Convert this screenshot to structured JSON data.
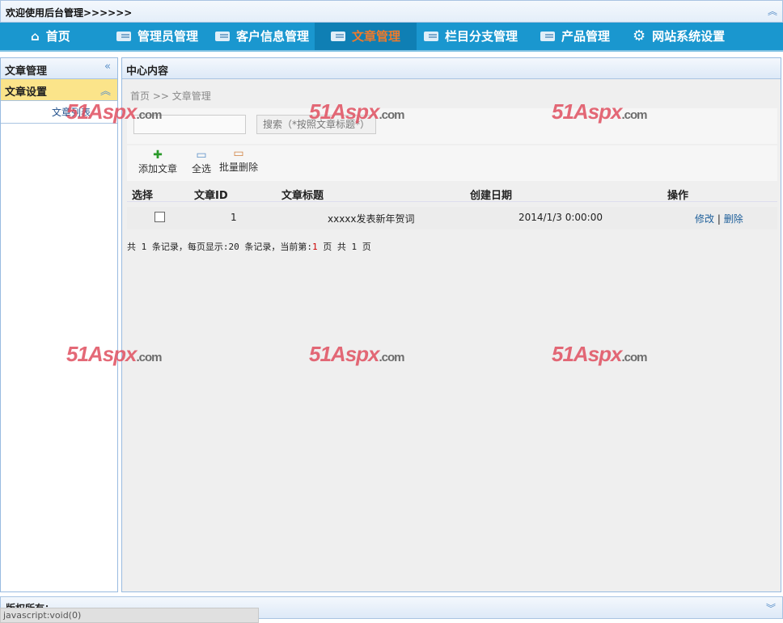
{
  "header": {
    "title": "欢迎使用后台管理>>>>>>",
    "collapse_icon": "double-chevron-up"
  },
  "nav": [
    {
      "label": "首页",
      "icon": "home-icon"
    },
    {
      "label": "管理员管理",
      "icon": "window-icon"
    },
    {
      "label": "客户信息管理",
      "icon": "window-icon"
    },
    {
      "label": "文章管理",
      "icon": "window-icon",
      "active": true
    },
    {
      "label": "栏目分支管理",
      "icon": "window-icon"
    },
    {
      "label": "产品管理",
      "icon": "window-icon"
    },
    {
      "label": "网站系统设置",
      "icon": "gear-icon"
    }
  ],
  "sidebar": {
    "title": "文章管理",
    "section": "文章设置",
    "items": [
      "文章列表"
    ]
  },
  "main": {
    "title": "中心内容",
    "breadcrumb": "首页 >> 文章管理",
    "search_value": "",
    "search_button": "搜索（*按照文章标题*）",
    "tools": [
      "添加文章",
      "全选",
      "批量删除"
    ],
    "columns": [
      "选择",
      "文章ID",
      "文章标题",
      "创建日期",
      "操作"
    ],
    "rows": [
      {
        "id": "1",
        "title": "xxxxx发表新年贺词",
        "date": "2014/1/3 0:00:00",
        "edit": "修改",
        "sep": "|",
        "delete": "删除"
      }
    ],
    "pager": {
      "a": "共 1 条记录，每页显示:20 条记录，当前第:",
      "current": "1",
      "b": " 页 共 1 页"
    }
  },
  "watermark": {
    "brand": "51Aspx",
    ".com": ".com"
  },
  "footer": {
    "text": "版权所有：-----"
  },
  "status": "javascript:void(0)"
}
